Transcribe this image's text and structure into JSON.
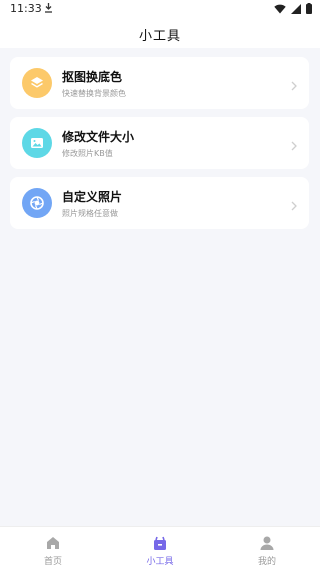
{
  "status_bar": {
    "time": "11:33"
  },
  "header": {
    "title": "小工具"
  },
  "tools": [
    {
      "title": "抠图换底色",
      "subtitle": "快速替换背景颜色",
      "icon": "layers-icon",
      "color": "#fcc96a"
    },
    {
      "title": "修改文件大小",
      "subtitle": "修改照片KB值",
      "icon": "image-icon",
      "color": "#5ed8e6"
    },
    {
      "title": "自定义照片",
      "subtitle": "照片规格任意做",
      "icon": "aperture-icon",
      "color": "#72a6f5"
    }
  ],
  "tabbar": {
    "items": [
      {
        "label": "首页",
        "icon": "home-icon",
        "active": false
      },
      {
        "label": "小工具",
        "icon": "toolbox-icon",
        "active": true
      },
      {
        "label": "我的",
        "icon": "user-icon",
        "active": false
      }
    ],
    "active_color": "#7668e8",
    "inactive_color": "#9a9a9a"
  }
}
